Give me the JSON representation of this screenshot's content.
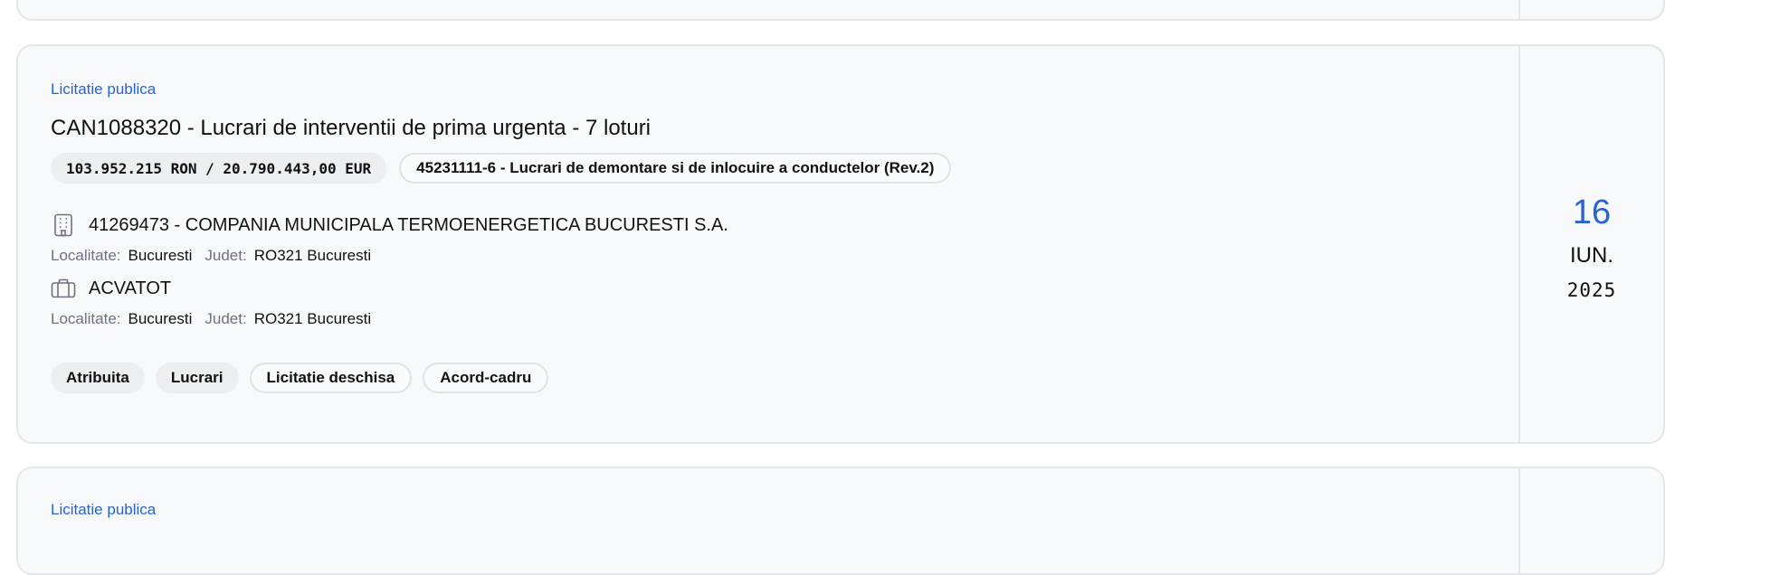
{
  "cards": [
    {
      "type_label": "Licitatie publica",
      "title": "CAN1088320 - Lucrari de interventii de prima urgenta - 7 loturi",
      "value": "103.952.215 RON / 20.790.443,00 EUR",
      "cpv": "45231111-6 - Lucrari de demontare si de inlocuire a conductelor (Rev.2)",
      "authority": {
        "name": "41269473 - COMPANIA MUNICIPALA TERMOENERGETICA BUCURESTI S.A.",
        "localitate_label": "Localitate:",
        "localitate": "Bucuresti",
        "judet_label": "Judet:",
        "judet": "RO321 Bucuresti"
      },
      "winner": {
        "name": "ACVATOT",
        "localitate_label": "Localitate:",
        "localitate": "Bucuresti",
        "judet_label": "Judet:",
        "judet": "RO321 Bucuresti"
      },
      "tags": [
        "Atribuita",
        "Lucrari",
        "Licitatie deschisa",
        "Acord-cadru"
      ],
      "date": {
        "day": "16",
        "month": "IUN.",
        "year": "2025"
      }
    },
    {
      "type_label": "Licitatie publica"
    }
  ],
  "colors": {
    "accent": "#2563d6",
    "card_bg": "#f8f9fb",
    "border": "#e4e6eb",
    "chip_bg": "#eceef2"
  },
  "icons": {
    "authority": "building-icon",
    "winner": "briefcase-icon"
  }
}
